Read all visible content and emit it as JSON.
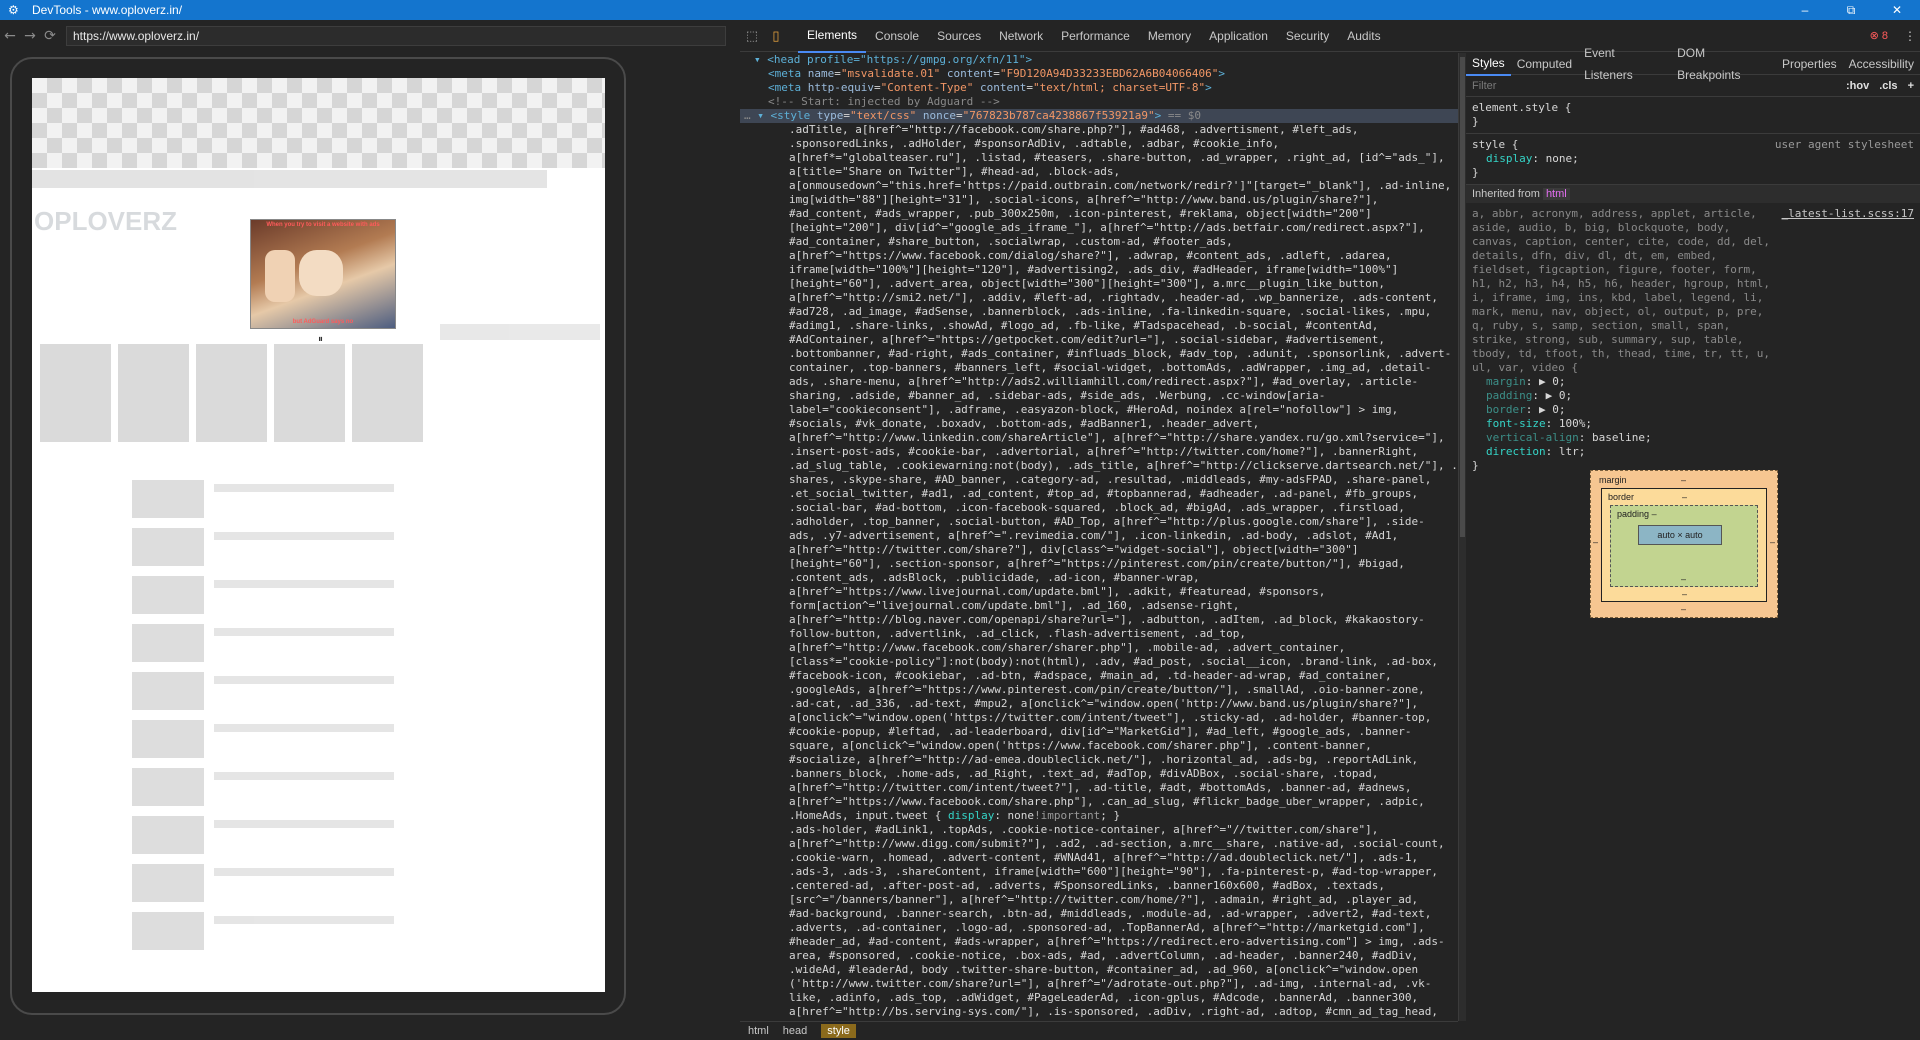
{
  "window": {
    "title": "DevTools - www.oploverz.in/",
    "min": "–",
    "max": "⧉",
    "close": "✕"
  },
  "browser": {
    "url": "https://www.oploverz.in/",
    "back": "←",
    "forward": "→",
    "reload": "⟳"
  },
  "page_preview": {
    "logo_text": "OPLOVERZ",
    "overlay_caption_top": "When you try to visit a website with ads",
    "overlay_caption_bottom": "but AdGuard says no",
    "pause_glyph": "⏸"
  },
  "devtools": {
    "tabs": [
      "Elements",
      "Console",
      "Sources",
      "Network",
      "Performance",
      "Memory",
      "Application",
      "Security",
      "Audits"
    ],
    "active_tab": "Elements",
    "error_count": "8",
    "error_icon": "⊗",
    "more_icon": "⋮",
    "inspect_icon": "⬚",
    "device_icon": "▯"
  },
  "elements": {
    "head_line": "<head profile=\"https://gmpg.org/xfn/11\">",
    "meta1_name": "msvalidate.01",
    "meta1_content": "F9D120A94D33233EBD62A6B04066406",
    "meta2_equiv": "Content-Type",
    "meta2_content": "text/html; charset=UTF-8",
    "comment": "<!-- Start: injected by Adguard -->",
    "style_type": "text/css",
    "style_nonce": "767823b787ca4238867f53921a9",
    "style_eq": "== $0",
    "css_lines": [
      ".adTitle, a[href^=\"http://facebook.com/share.php?\"], #ad468, .advertisment, #left_ads,",
      ".sponsoredLinks, .adHolder, #sponsorAdDiv, .adtable, .adbar, #cookie_info,",
      "a[href*=\"globalteaser.ru\"], .listad, #teasers, .share-button, .ad_wrapper, .right_ad, [id^=\"ads_\"],",
      "a[title=\"Share on Twitter\"], #head-ad, .block-ads,",
      "a[onmousedown^=\"this.href='https://paid.outbrain.com/network/redir?']\"[target=\"_blank\"], .ad-inline,",
      "img[width=\"88\"][height=\"31\"], .social-icons, a[href^=\"http://www.band.us/plugin/share?\"],",
      "#ad_content, #ads_wrapper, .pub_300x250m, .icon-pinterest, #reklama, object[width=\"200\"]",
      "[height=\"200\"], div[id^=\"google_ads_iframe_\"], a[href^=\"http://ads.betfair.com/redirect.aspx?\"],",
      "#ad_container, #share_button, .socialwrap, .custom-ad, #footer_ads,",
      "a[href^=\"https://www.facebook.com/dialog/share?\"], .adwrap, #content_ads, .adleft, .adarea,",
      "iframe[width=\"100%\"][height=\"120\"], #advertising2, .ads_div, #adHeader, iframe[width=\"100%\"]",
      "[height=\"60\"], .advert_area, object[width=\"300\"][height=\"300\"], a.mrc__plugin_like_button,",
      "a[href^=\"http://smi2.net/\"], .addiv, #left-ad, .rightadv, .header-ad, .wp_bannerize, .ads-content,",
      "#ad728, .ad_image, #adSense, .bannerblock, .ads-inline, .fa-linkedin-square, .social-likes, .mpu,",
      "#adimg1, .share-links, .showAd, #logo_ad, .fb-like, #Tadspacehead, .b-social, #contentAd,",
      "#AdContainer, a[href^=\"https://getpocket.com/edit?url=\"], .social-sidebar, #advertisement,",
      ".bottombanner, #ad-right, #ads_container, #influads_block, #adv_top, .adunit, .sponsorlink, .advert-",
      "container, .top-banners, #banners_left, #social-widget, .bottomAds, .adWrapper, .img_ad, .detail-",
      "ads, .share-menu, a[href^=\"http://ads2.williamhill.com/redirect.aspx?\"], #ad_overlay, .article-",
      "sharing, .adside, #banner_ad, .sidebar-ads, #side_ads, .Werbung, .cc-window[aria-",
      "label=\"cookieconsent\"], .adframe, .easyazon-block, #HeroAd, noindex a[rel=\"nofollow\"] > img,",
      "#socials, #vk_donate, .boxadv, .bottom-ads, #adBanner1, .header_advert,",
      "a[href^=\"http://www.linkedin.com/shareArticle\"], a[href^=\"http://share.yandex.ru/go.xml?service=\"],",
      ".insert-post-ads, #cookie-bar, .advertorial, a[href^=\"http://twitter.com/home?\"], .bannerRight,",
      ".ad_slug_table, .cookiewarning:not(body), .ads_title, a[href^=\"http://clickserve.dartsearch.net/\"], .sticky-",
      "shares, .skype-share, #AD_banner, .category-ad, .resultad, .middleads, #my-adsFPAD, .share-panel,",
      ".et_social_twitter, #ad1, .ad_content, #top_ad, #topbannerad, #adheader, .ad-panel, #fb_groups,",
      ".social-bar, #ad-bottom, .icon-facebook-squared, .block_ad, #bigAd, .ads_wrapper, .firstload,",
      ".adholder, .top_banner, .social-button, #AD_Top, a[href^=\"http://plus.google.com/share\"], .side-",
      "ads, .y7-advertisement, a[href^=\".revimedia.com/\"], .icon-linkedin, .ad-body, .adslot, #Ad1,",
      "a[href^=\"http://twitter.com/share?\"], div[class^=\"widget-social\"], object[width=\"300\"]",
      "[height=\"60\"], .section-sponsor, a[href^=\"https://pinterest.com/pin/create/button/\"], #bigad,",
      ".content_ads, .adsBlock, .publicidade, .ad-icon, #banner-wrap,",
      "a[href^=\"https://www.livejournal.com/update.bml\"], .adkit, #featuread, #sponsors,",
      "form[action^=\"livejournal.com/update.bml\"], .ad_160, .adsense-right,",
      "a[href^=\"http://blog.naver.com/openapi/share?url=\"], .adbutton, .adItem, .ad_block, #kakaostory-",
      "follow-button, .advertlink, .ad_click, .flash-advertisement, .ad_top,",
      "a[href^=\"http://www.facebook.com/sharer/sharer.php\"], .mobile-ad, .advert_container,",
      "[class*=\"cookie-policy\"]:not(body):not(html), .adv, #ad_post, .social__icon, .brand-link, .ad-box,",
      "#facebook-icon, #cookiebar, .ad-btn, #adspace, #main_ad, .td-header-ad-wrap, #ad_container,",
      ".googleAds, a[href^=\"https://www.pinterest.com/pin/create/button/\"], .smallAd, .oio-banner-zone,",
      ".ad-cat, .ad_336, .ad-text, #mpu2, a[onclick^=\"window.open('http://www.band.us/plugin/share?\"],",
      "a[onclick^=\"window.open('https://twitter.com/intent/tweet\"], .sticky-ad, .ad-holder, #banner-top,",
      "#cookie-popup, #leftad, .ad-leaderboard, div[id^=\"MarketGid\"], #ad_left, #google_ads, .banner-",
      "square, a[onclick^=\"window.open('https://www.facebook.com/sharer.php\"], .content-banner,",
      "#socialize, a[href^=\"http://ad-emea.doubleclick.net/\"], .horizontal_ad, .ads-bg, .reportAdLink,",
      ".banners_block, .home-ads, .ad_Right, .text_ad, #adTop, #divADBox, .social-share, .topad,",
      "a[href^=\"http://twitter.com/intent/tweet?\"], .ad-title, #adt, #bottomAds, .banner-ad, #adnews,",
      "a[href^=\"https://www.facebook.com/share.php\"], .can_ad_slug, #flickr_badge_uber_wrapper, .adpic,",
      ".HomeAds, input.tweet { display: none!important; }",
      ".ads-holder, #adLink1, .topAds, .cookie-notice-container, a[href^=\"//twitter.com/share\"],",
      "a[href^=\"http://www.digg.com/submit?\"], .ad2, .ad-section, a.mrc__share, .native-ad, .social-count,",
      ".cookie-warn, .homead, .advert-content, #WNAd41, a[href^=\"http://ad.doubleclick.net/\"], .ads-1,",
      ".ads-3, .ads-3, .shareContent, iframe[width=\"600\"][height=\"90\"], .fa-pinterest-p, #ad-top-wrapper,",
      ".centered-ad, .after-post-ad, .adverts, #SponsoredLinks, .banner160x600, #adBox, .textads,",
      "[src^=\"/banners/banner\"], a[href^=\"http://twitter.com/home/?\"], .admain, #right_ad, .player_ad,",
      "#ad-background, .banner-search, .btn-ad, #middleads, .module-ad, .ad-wrapper, .advert2, #ad-text,",
      ".adverts, .ad-container, .logo-ad, .sponsored-ad, .TopBannerAd, a[href^=\"http://marketgid.com\"],",
      "#header_ad, #ad-content, #ads-wrapper, a[href^=\"https://redirect.ero-advertising.com\"] > img, .ads-",
      "area, #sponsored, .cookie-notice, .box-ads, #ad, .advertColumn, .ad-header, .banner240, #adDiv,",
      ".wideAd, #leaderAd, body .twitter-share-button, #container_ad, .ad_960, a[onclick^=\"window.open",
      "('http://www.twitter.com/share?url=\"], a[href^=\"/adrotate-out.php?\"], .ad-img, .internal-ad, .vk-",
      "like, .adinfo, .ads_top, .adWidget, #PageLeaderAd, .icon-gplus, #Adcode, .bannerAd, .banner300,",
      "a[href^=\"http://bs.serving-sys.com/\"], .is-sponsored, .adDiv, .right-ad, .adtop, #cmn_ad_tag_head,"
    ],
    "breadcrumbs": [
      "html",
      "head",
      "style"
    ]
  },
  "styles_pane": {
    "tabs": [
      "Styles",
      "Computed",
      "Event Listeners",
      "DOM Breakpoints",
      "Properties",
      "Accessibility"
    ],
    "active_tab": "Styles",
    "filter_placeholder": "Filter",
    "hov": ":hov",
    "cls": ".cls",
    "add": "+",
    "element_style": "element.style {",
    "close_brace": "}",
    "rule1_selector": "style {",
    "rule1_source": "user agent stylesheet",
    "rule1_prop": "display",
    "rule1_val": "none;",
    "inherited_label": "Inherited from",
    "inherited_tag": "html",
    "rule2_source": "_latest-list.scss:17",
    "rule2_selectors": "a, abbr, acronym, address, applet, article, aside, audio, b, big, blockquote, body, canvas, caption, center, cite, code, dd, del, details, dfn, div, dl, dt, em, embed, fieldset, figcaption, figure, footer, form, h1, h2, h3, h4, h5, h6, header, hgroup, html, i, iframe, img, ins, kbd, label, legend, li, mark, menu, nav, object, ol, output, p, pre, q, ruby, s, samp, section, small, span, strike, strong, sub, summary, sup, table, tbody, td, tfoot, th, thead, time, tr, tt, u, ul, var, video {",
    "rule2_props": [
      {
        "name": "margin",
        "value": "▶ 0;",
        "dim": true
      },
      {
        "name": "padding",
        "value": "▶ 0;",
        "dim": true
      },
      {
        "name": "border",
        "value": "▶ 0;",
        "dim": true
      },
      {
        "name": "font-size",
        "value": "100%;",
        "dim": false
      },
      {
        "name": "vertical-align",
        "value": "baseline;",
        "dim": true
      },
      {
        "name": "direction",
        "value": "ltr;",
        "dim": false
      }
    ],
    "box_model": {
      "margin_label": "margin",
      "border_label": "border",
      "padding_label": "padding",
      "content": "auto × auto",
      "dash": "–"
    }
  }
}
